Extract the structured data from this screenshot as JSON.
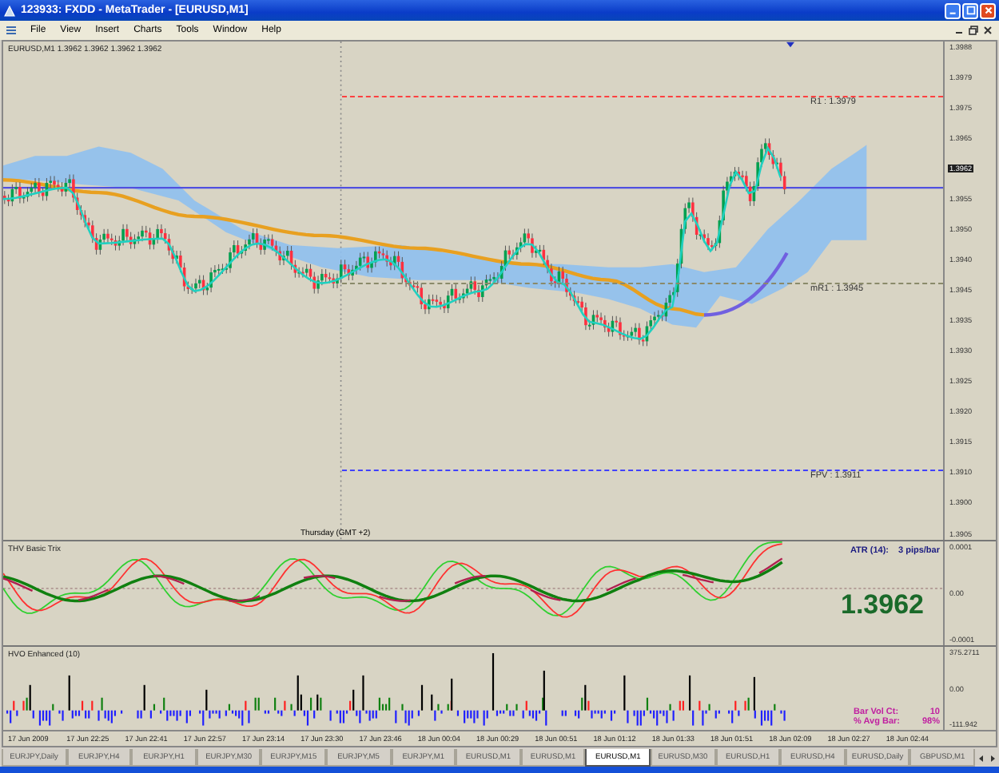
{
  "window": {
    "title": "123933: FXDD - MetaTrader - [EURUSD,M1]"
  },
  "menu": [
    "File",
    "View",
    "Insert",
    "Charts",
    "Tools",
    "Window",
    "Help"
  ],
  "chart": {
    "header": "EURUSD,M1  1.3962 1.3962 1.3962 1.3962",
    "price_axis": [
      {
        "kind": "tick",
        "label": "1.3988"
      },
      {
        "kind": "tick",
        "label": "1.3979"
      },
      {
        "kind": "tick",
        "label": "1.3975"
      },
      {
        "kind": "tick",
        "label": "1.3965"
      },
      {
        "kind": "current",
        "label": "1.3962"
      },
      {
        "kind": "tick",
        "label": "1.3955"
      },
      {
        "kind": "tick",
        "label": "1.3950"
      },
      {
        "kind": "tick",
        "label": "1.3940"
      },
      {
        "kind": "tick",
        "label": "1.3945"
      },
      {
        "kind": "tick",
        "label": "1.3935"
      },
      {
        "kind": "tick",
        "label": "1.3930"
      },
      {
        "kind": "tick",
        "label": "1.3925"
      },
      {
        "kind": "tick",
        "label": "1.3920"
      },
      {
        "kind": "tick",
        "label": "1.3915"
      },
      {
        "kind": "tick",
        "label": "1.3910"
      },
      {
        "kind": "tick",
        "label": "1.3900"
      },
      {
        "kind": "tick",
        "label": "1.3905"
      }
    ],
    "levels": [
      {
        "label": "R1 : 1.3979",
        "color": "#ff4040"
      },
      {
        "label": "mR1 : 1.3945",
        "color": "#8a8a6a"
      },
      {
        "label": "FPV : 1.3911",
        "color": "#4040ff"
      }
    ],
    "session_label": "Thursday   (GMT +2)"
  },
  "oscillator": {
    "title": "THV Basic Trix",
    "atr_label": "ATR (14):",
    "atr_value": "3 pips/bar",
    "price": "1.3962",
    "axis": [
      "0.0001",
      "0.00",
      "-0.0001"
    ]
  },
  "volume": {
    "title": "HVO Enhanced (10)",
    "axis": [
      "375.2711",
      "0.00",
      "-111.942"
    ],
    "stats": [
      {
        "label": "Bar Vol Ct:",
        "value": "10"
      },
      {
        "label": "% Avg Bar:",
        "value": "98%"
      }
    ]
  },
  "time_axis": [
    "17 Jun 2009",
    "17 Jun 22:25",
    "17 Jun 22:41",
    "17 Jun 22:57",
    "17 Jun 23:14",
    "17 Jun 23:30",
    "17 Jun 23:46",
    "18 Jun 00:04",
    "18 Jun 00:29",
    "18 Jun 00:51",
    "18 Jun 01:12",
    "18 Jun 01:33",
    "18 Jun 01:51",
    "18 Jun 02:09",
    "18 Jun 02:27",
    "18 Jun 02:44"
  ],
  "tabs": [
    {
      "label": "EURJPY,Daily",
      "selected": false
    },
    {
      "label": "EURJPY,H4",
      "selected": false
    },
    {
      "label": "EURJPY,H1",
      "selected": false
    },
    {
      "label": "EURJPY,M30",
      "selected": false
    },
    {
      "label": "EURJPY,M15",
      "selected": false
    },
    {
      "label": "EURJPY,M5",
      "selected": false
    },
    {
      "label": "EURJPY,M1",
      "selected": false
    },
    {
      "label": "EURUSD,M1",
      "selected": false
    },
    {
      "label": "EURUSD,M1",
      "selected": false
    },
    {
      "label": "EURUSD,M1",
      "selected": true
    },
    {
      "label": "EURUSD,M30",
      "selected": false
    },
    {
      "label": "EURUSD,H1",
      "selected": false
    },
    {
      "label": "EURUSD,H4",
      "selected": false
    },
    {
      "label": "EURUSD,Daily",
      "selected": false
    },
    {
      "label": "GBPUSD,M1",
      "selected": false
    }
  ]
}
